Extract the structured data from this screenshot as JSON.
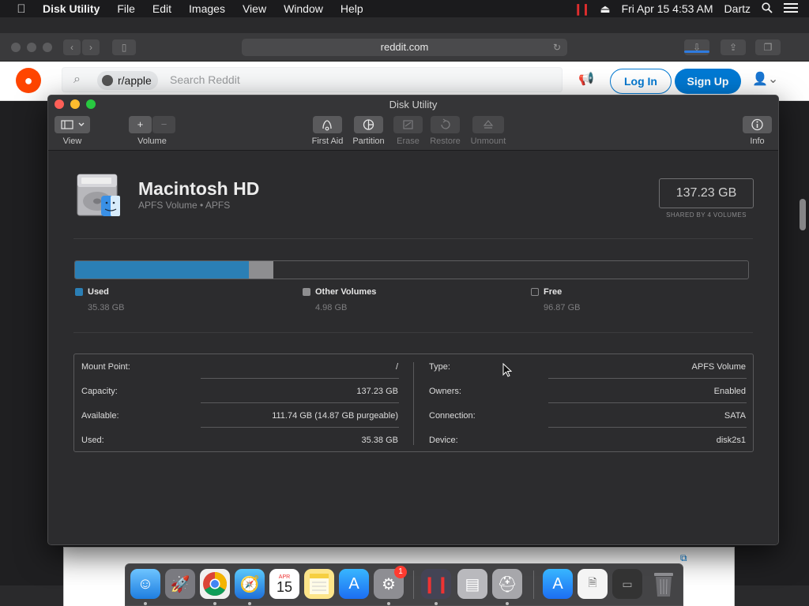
{
  "menubar": {
    "apple": "",
    "items": [
      "Disk Utility",
      "File",
      "Edit",
      "Images",
      "View",
      "Window",
      "Help"
    ],
    "clock": "Fri Apr 15  4:53 AM",
    "user": "Dartz"
  },
  "safari": {
    "url": "reddit.com",
    "reddit": {
      "community": "r/apple",
      "search_placeholder": "Search Reddit",
      "login": "Log In",
      "signup": "Sign Up"
    }
  },
  "disk_utility": {
    "title": "Disk Utility",
    "toolbar": {
      "view": "View",
      "volume": "Volume",
      "first_aid": "First Aid",
      "partition": "Partition",
      "erase": "Erase",
      "restore": "Restore",
      "unmount": "Unmount",
      "info": "Info"
    },
    "volume": {
      "name": "Macintosh HD",
      "subtitle": "APFS Volume • APFS",
      "capacity": "137.23 GB",
      "shared": "SHARED BY 4 VOLUMES"
    },
    "usage": {
      "used_fraction": 0.258,
      "other_fraction": 0.036,
      "used": {
        "label": "Used",
        "value": "35.38 GB",
        "color": "#2b7fb5"
      },
      "other": {
        "label": "Other Volumes",
        "value": "4.98 GB",
        "color": "#8e8e90"
      },
      "free": {
        "label": "Free",
        "value": "96.87 GB",
        "color": "#2e2e30"
      }
    },
    "info": {
      "left": [
        {
          "k": "Mount Point:",
          "v": "/"
        },
        {
          "k": "Capacity:",
          "v": "137.23 GB"
        },
        {
          "k": "Available:",
          "v": "111.74 GB (14.87 GB purgeable)"
        },
        {
          "k": "Used:",
          "v": "35.38 GB"
        }
      ],
      "right": [
        {
          "k": "Type:",
          "v": "APFS Volume"
        },
        {
          "k": "Owners:",
          "v": "Enabled"
        },
        {
          "k": "Connection:",
          "v": "SATA"
        },
        {
          "k": "Device:",
          "v": "disk2s1"
        }
      ]
    }
  },
  "dock": {
    "calendar_month": "APR",
    "calendar_day": "15",
    "settings_badge": "1"
  }
}
